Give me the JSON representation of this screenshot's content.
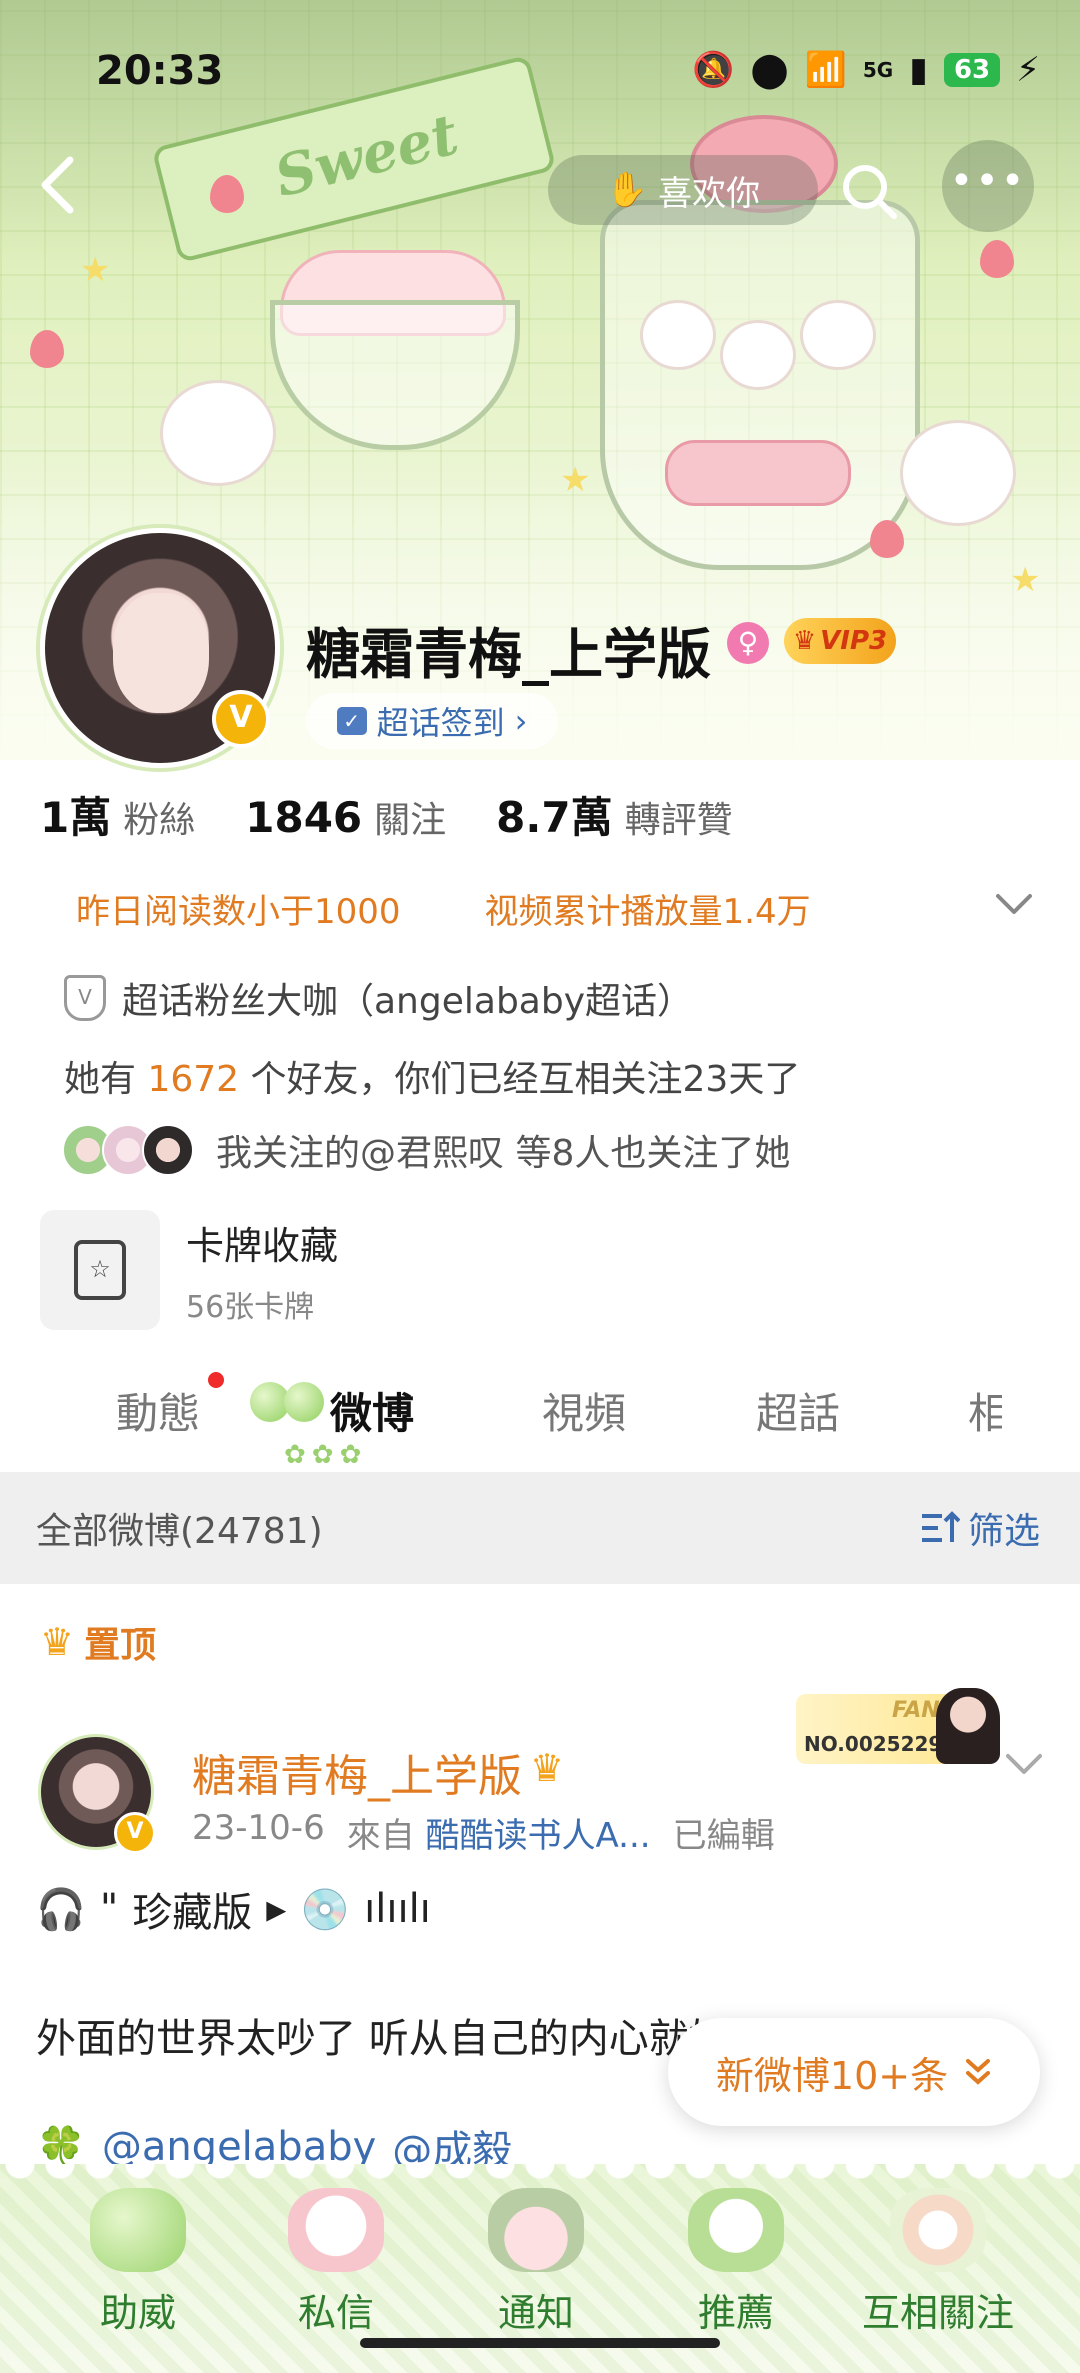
{
  "status_bar": {
    "time": "20:33",
    "network": "5G",
    "battery": "63"
  },
  "nav": {
    "back_icon": "chevron-left-icon",
    "like_label": "喜欢你",
    "search_icon": "search-icon",
    "more_icon": "more-dots-icon"
  },
  "banner": {
    "ribbon_text": "Sweet"
  },
  "profile": {
    "username": "糖霜青梅_上学版",
    "verified_mark": "V",
    "gender_icon": "female-icon",
    "vip_label": "VIP3",
    "checkin_label": "超话签到",
    "checkin_chevron": "›"
  },
  "stats": [
    {
      "value": "1萬",
      "label": "粉絲"
    },
    {
      "value": "1846",
      "label": "關注"
    },
    {
      "value": "8.7萬",
      "label": "轉評贊"
    }
  ],
  "info": {
    "reads": "昨日阅读数小于1000",
    "video_plays": "视频累计播放量1.4万",
    "superfan": "超话粉丝大咖（angelababy超话）",
    "friends_prefix": "她有 ",
    "friends_count": "1672",
    "friends_suffix": " 个好友，你们已经互相关注23天了",
    "mutual_follow": "我关注的@君熙叹 等8人也关注了她"
  },
  "cards": {
    "title": "卡牌收藏",
    "subtitle": "56张卡牌"
  },
  "tabs": [
    {
      "label": "動態"
    },
    {
      "label": "微博"
    },
    {
      "label": "視頻"
    },
    {
      "label": "超話"
    },
    {
      "label": "相"
    }
  ],
  "filter": {
    "label": "全部微博(24781)",
    "button": "筛选"
  },
  "pinned_label": "置顶",
  "post": {
    "author": "糖霜青梅_上学版",
    "date": "23-10-6",
    "from_prefix": "來自",
    "source": "酷酷读书人A...",
    "edited": "已編輯",
    "fans_title": "FANS",
    "fans_no": "NO.0025229",
    "line1_quote": "\"",
    "line1_text": "珍藏版",
    "line1_bars": "ılıılı",
    "line2": "外面的世界太吵了 听从自己的内心就好了",
    "mention1": "@angelababy",
    "mention2": "@成毅"
  },
  "new_posts": {
    "label": "新微博10+条",
    "icon": "double-chevron-down-icon"
  },
  "bottom_nav": [
    {
      "label": "助威"
    },
    {
      "label": "私信"
    },
    {
      "label": "通知"
    },
    {
      "label": "推薦"
    },
    {
      "label": "互相關注"
    }
  ],
  "colors": {
    "accent_orange": "#e07b21",
    "link_blue": "#3b6cb0",
    "theme_green": "#d7ebba",
    "verified_gold": "#f5b40a"
  }
}
